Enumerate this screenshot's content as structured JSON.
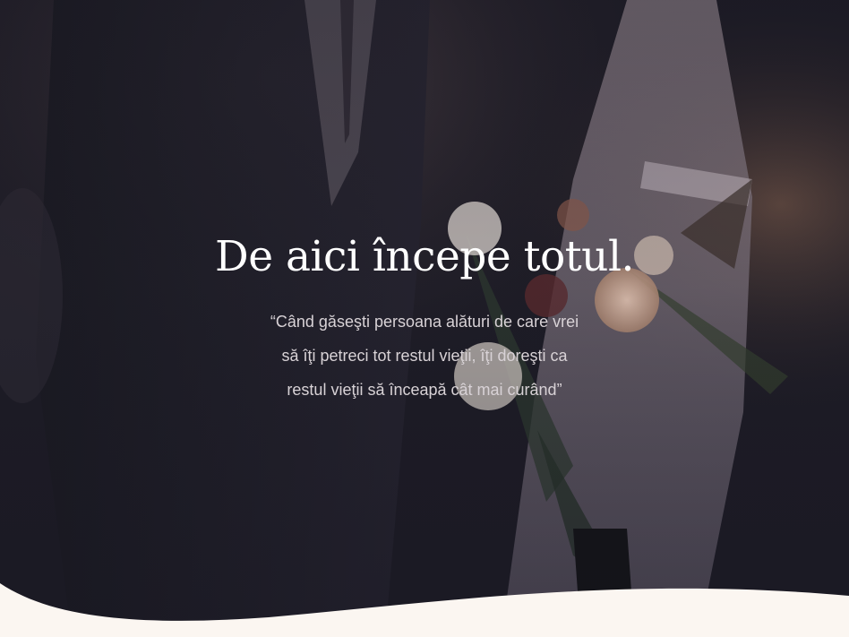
{
  "hero": {
    "title": "De aici începe totul.",
    "quote": "“Când găseşti persoana alături de care vrei să îţi petreci tot restul vieţii, îţi doreşti ca restul vieţii să înceapă cât mai curând”"
  },
  "colors": {
    "overlay": "#1c1b24",
    "footer_background": "#fbf6f1",
    "title": "#ffffff",
    "quote": "#d8d2d6"
  }
}
